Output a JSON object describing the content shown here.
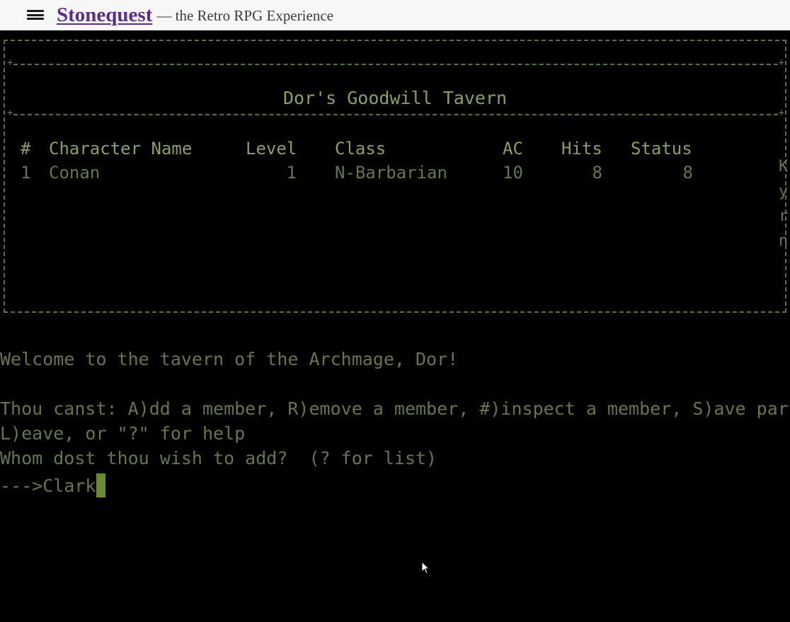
{
  "header": {
    "brand": "Stonequest",
    "tagline": "— the Retro RPG Experience"
  },
  "tavern": {
    "title": "Dor's Goodwill Tavern",
    "columns": [
      "#",
      "Character Name",
      "Level",
      "Class",
      "AC",
      "Hits",
      "Status"
    ],
    "rows": [
      [
        "1",
        "Conan",
        "1",
        "N-Barbarian",
        "10",
        "8",
        "8"
      ]
    ],
    "side_chars": [
      "K",
      "y",
      "r",
      "n"
    ]
  },
  "messages": {
    "welcome": "Welcome to the tavern of the Archmage, Dor!",
    "options_line1": "Thou canst: A)dd a member, R)emove a member, #)inspect a member, S)ave party,",
    "options_line2": "L)eave, or \"?\" for help",
    "question": "Whom dost thou wish to add?  (? for list)",
    "prompt": "--->",
    "input_value": "Clark"
  },
  "colors": {
    "terminal_text": "#66764a",
    "terminal_bright": "#8ca05e",
    "cursor": "#6b8a33",
    "brand": "#5b2f86"
  }
}
